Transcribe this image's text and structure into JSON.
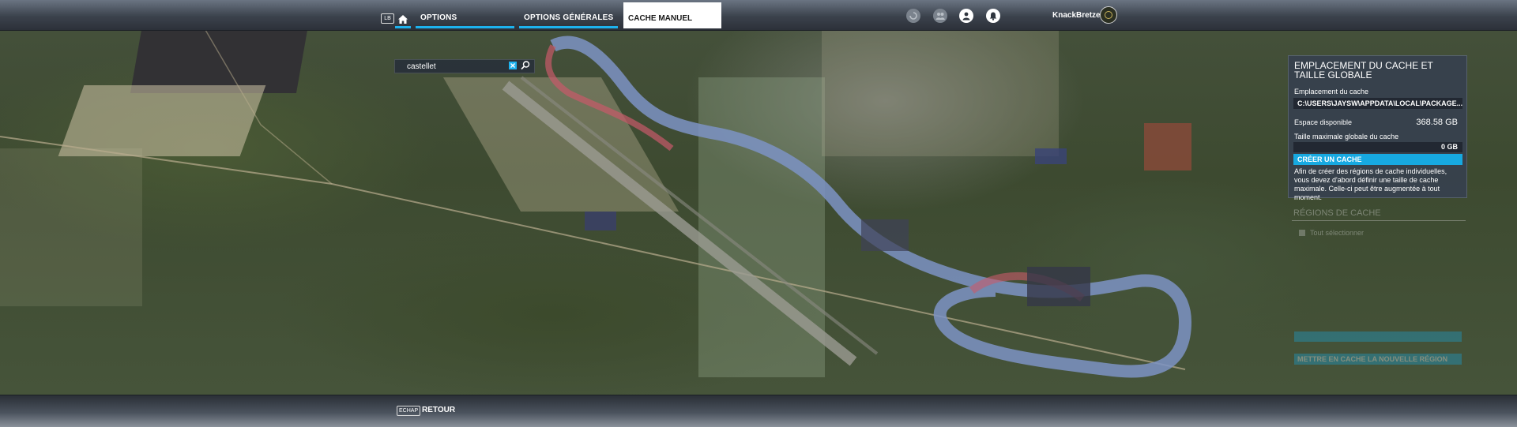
{
  "topbar": {
    "lb_key": "LB",
    "tabs": [
      {
        "label": "OPTIONS"
      },
      {
        "label": "OPTIONS GÉNÉRALES"
      },
      {
        "label": "CACHE MANUEL"
      }
    ],
    "icons": [
      "activity-icon",
      "friends-icon",
      "profile-icon",
      "notifications-icon"
    ],
    "username": "KnackBretzel"
  },
  "search": {
    "value": "castellet"
  },
  "panel": {
    "title": "EMPLACEMENT DU CACHE ET TAILLE GLOBALE",
    "location_label": "Emplacement du cache",
    "location_value": "C:\\USERS\\JAYSW\\APPDATA\\LOCAL\\PACKAGE...",
    "space_label": "Espace disponible",
    "space_value": "368.58 GB",
    "max_size_label": "Taille maximale globale du cache",
    "max_size_value": "0 GB",
    "create_button": "CRÉER UN CACHE",
    "description": "Afin de créer des régions de cache individuelles, vous devez d'abord définir une taille de cache maximale. Celle-ci peut être augmentée à tout moment."
  },
  "regions": {
    "title": "RÉGIONS DE CACHE",
    "select_all": "Tout sélectionner",
    "add_button": "METTRE EN CACHE LA NOUVELLE RÉGION"
  },
  "bottombar": {
    "esc_key": "ECHAP",
    "back_label": "RETOUR"
  },
  "colors": {
    "accent": "#1db2ee",
    "panel_bg": "#36404e"
  }
}
